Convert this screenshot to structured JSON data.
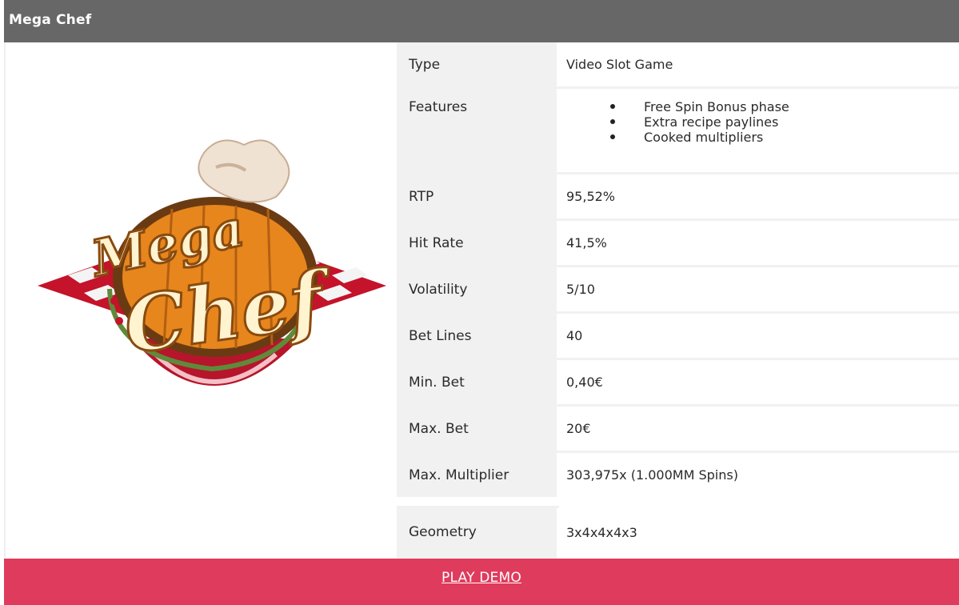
{
  "header": {
    "title": "Mega Chef"
  },
  "logo": {
    "icon": "mega-chef-logo",
    "line1": "Mega",
    "line2": "Chef"
  },
  "details": {
    "type": {
      "label": "Type",
      "value": "Video Slot Game"
    },
    "features": {
      "label": "Features",
      "items": [
        "Free Spin Bonus phase",
        "Extra recipe paylines",
        "Cooked multipliers"
      ]
    },
    "rtp": {
      "label": "RTP",
      "value": "95,52%"
    },
    "hit_rate": {
      "label": "Hit Rate",
      "value": "41,5%"
    },
    "volatility": {
      "label": "Volatility",
      "value": "5/10"
    },
    "bet_lines": {
      "label": "Bet Lines",
      "value": "40"
    },
    "min_bet": {
      "label": "Min. Bet",
      "value": "0,40€"
    },
    "max_bet": {
      "label": "Max. Bet",
      "value": "20€"
    },
    "max_multiplier": {
      "label": "Max. Multiplier",
      "value": "303,975x (1.000MM Spins)"
    },
    "geometry": {
      "label": "Geometry",
      "value": "3x4x4x4x3"
    }
  },
  "cta": {
    "label": "PLAY DEMO"
  },
  "colors": {
    "header_bg": "#676767",
    "cta_bg": "#df3b5c",
    "label_bg": "#f1f1f1"
  }
}
